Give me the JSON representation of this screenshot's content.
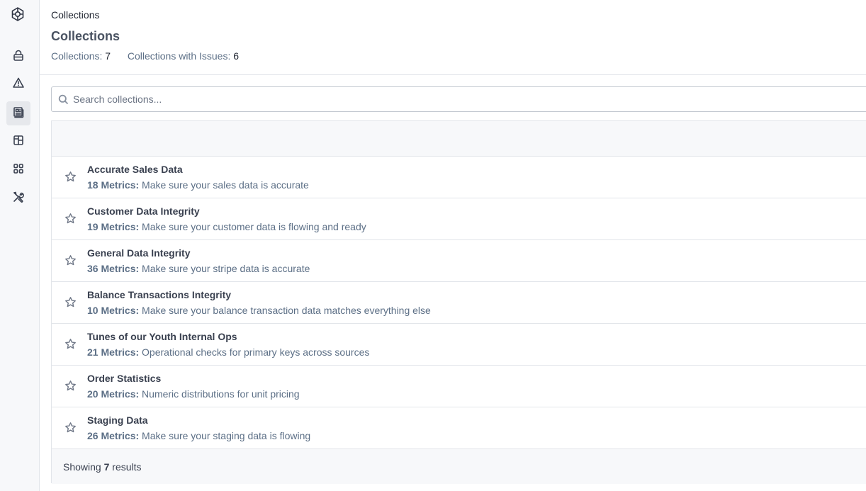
{
  "header": {
    "breadcrumb": "Collections",
    "title": "Collections",
    "stats": {
      "collections_label": "Collections:",
      "collections_value": "7",
      "issues_label": "Collections with Issues:",
      "issues_value": "6"
    }
  },
  "search": {
    "placeholder": "Search collections..."
  },
  "sidebar": {
    "icons": [
      "logo-icon",
      "lock-icon",
      "warning-icon",
      "collections-icon",
      "dashboard-icon",
      "apps-icon",
      "tools-icon"
    ]
  },
  "rows": [
    {
      "title": "Accurate Sales Data",
      "count": "18 Metrics:",
      "desc": "Make sure your sales data is accurate"
    },
    {
      "title": "Customer Data Integrity",
      "count": "19 Metrics:",
      "desc": "Make sure your customer data is flowing and ready"
    },
    {
      "title": "General Data Integrity",
      "count": "36 Metrics:",
      "desc": "Make sure your stripe data is accurate"
    },
    {
      "title": "Balance Transactions Integrity",
      "count": "10 Metrics:",
      "desc": "Make sure your balance transaction data matches everything else"
    },
    {
      "title": "Tunes of our Youth Internal Ops",
      "count": "21 Metrics:",
      "desc": "Operational checks for primary keys across sources"
    },
    {
      "title": "Order Statistics",
      "count": "20 Metrics:",
      "desc": "Numeric distributions for unit pricing"
    },
    {
      "title": "Staging Data",
      "count": "26 Metrics:",
      "desc": "Make sure your staging data is flowing"
    }
  ],
  "footer": {
    "prefix": "Showing",
    "count": "7",
    "suffix": "results"
  }
}
